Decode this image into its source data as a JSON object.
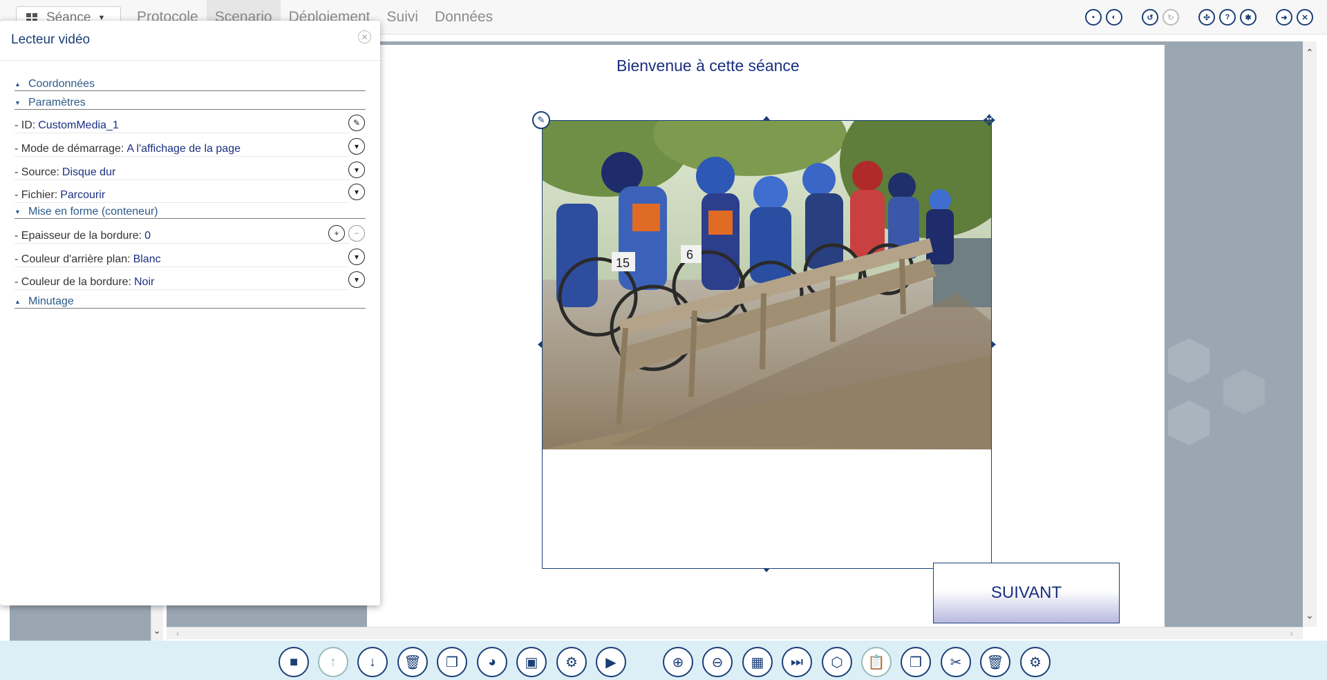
{
  "topbar": {
    "seance_label": "Séance",
    "menu": [
      {
        "label": "Protocole"
      },
      {
        "label": "Scenario"
      },
      {
        "label": "Déploiement"
      },
      {
        "label": "Suivi"
      },
      {
        "label": "Données"
      }
    ],
    "active_menu": "Scenario"
  },
  "panel": {
    "title": "Lecteur vidéo",
    "sections": {
      "coordonnees": "Coordonnées",
      "parametres": "Paramètres",
      "mise_en_forme": "Mise en forme (conteneur)",
      "minutage": "Minutage"
    },
    "rows": {
      "id_label": "- ID:",
      "id_value": "CustomMedia_1",
      "mode_label": "- Mode de démarrage:",
      "mode_value": "A l'affichage de la page",
      "source_label": "- Source:",
      "source_value": "Disque dur",
      "fichier_label": "- Fichier:",
      "fichier_value": "Parcourir",
      "epaisseur_label": "- Epaisseur de la bordure:",
      "epaisseur_value": "0",
      "couleur_fond_label": "- Couleur d'arrière plan:",
      "couleur_fond_value": "Blanc",
      "couleur_bordure_label": "- Couleur de la bordure:",
      "couleur_bordure_value": "Noir"
    }
  },
  "canvas": {
    "welcome_text": "Bienvenue à cette séance",
    "next_button": "SUIVANT"
  },
  "colors": {
    "accent": "#1a3e76",
    "canvas_bg": "#9aa7b2",
    "bottom_bar": "#dceff7"
  }
}
